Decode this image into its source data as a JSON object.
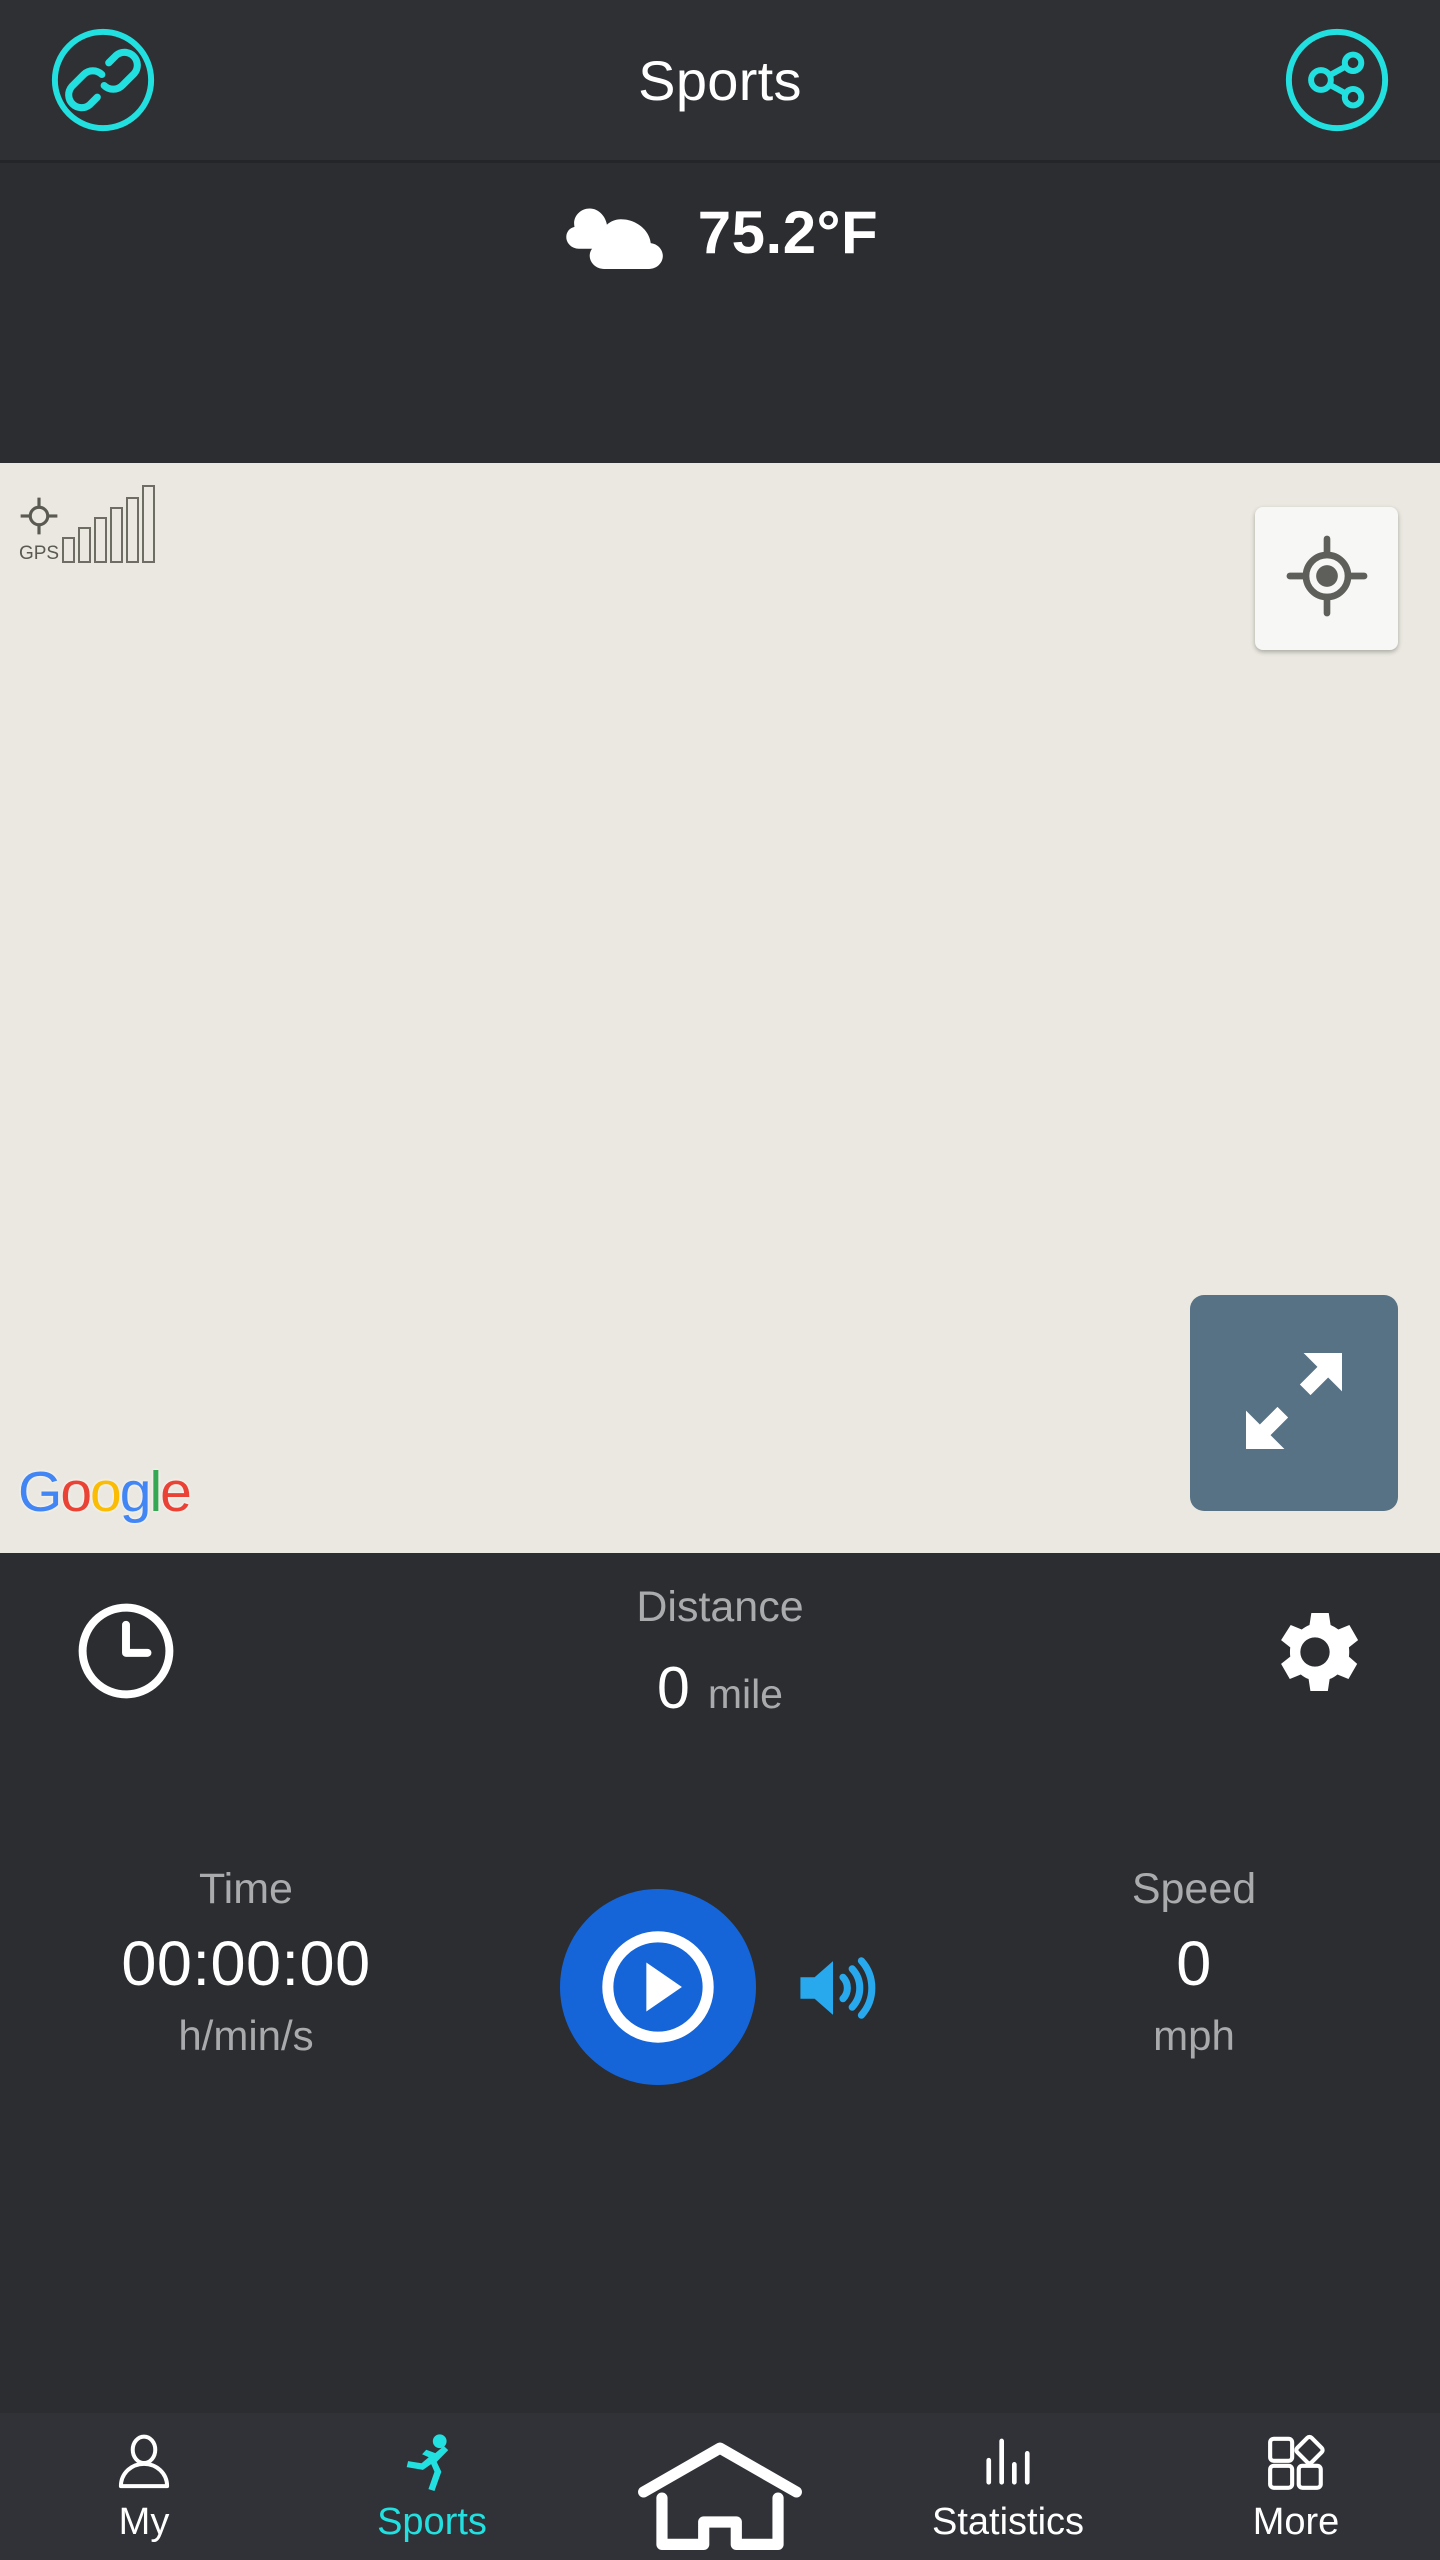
{
  "header": {
    "title": "Sports",
    "left_icon": "link-icon",
    "right_icon": "share-icon",
    "accent_color": "#22e0e0",
    "background_color": "#2e3034"
  },
  "weather": {
    "icon": "cloudy-icon",
    "temperature": "75.2°F"
  },
  "map": {
    "background_color": "#eae8e0",
    "gps": {
      "label": "GPS",
      "icon": "gps-crosshair-icon",
      "bars": 6,
      "bars_filled": 0
    },
    "locate_button": {
      "icon": "my-location-icon",
      "background_color": "#f7f7f5"
    },
    "expand_button": {
      "icon": "expand-arrows-icon",
      "background_color": "#577285"
    },
    "attribution": {
      "name": "Google",
      "letters": [
        {
          "char": "G",
          "color": "#4285F4"
        },
        {
          "char": "o",
          "color": "#EA4335"
        },
        {
          "char": "o",
          "color": "#FBBC05"
        },
        {
          "char": "g",
          "color": "#4285F4"
        },
        {
          "char": "l",
          "color": "#34A853"
        },
        {
          "char": "e",
          "color": "#EA4335"
        }
      ]
    }
  },
  "stats": {
    "background_color": "#2b2d31",
    "history_button": {
      "icon": "clock-icon"
    },
    "settings_button": {
      "icon": "gear-icon"
    },
    "distance": {
      "label": "Distance",
      "value": "0",
      "unit": "mile"
    },
    "time": {
      "label": "Time",
      "value": "00:00:00",
      "unit": "h/min/s"
    },
    "speed": {
      "label": "Speed",
      "value": "0",
      "unit": "mph"
    },
    "start_button": {
      "icon": "play-icon",
      "color": "#1565d8"
    },
    "sound_button": {
      "icon": "volume-up-icon",
      "color": "#28a9ee"
    }
  },
  "nav": {
    "background_color": "#303237",
    "active_color": "#22e0e0",
    "items": [
      {
        "id": "my",
        "label": "My",
        "icon": "person-icon",
        "active": false
      },
      {
        "id": "sports",
        "label": "Sports",
        "icon": "running-icon",
        "active": true
      },
      {
        "id": "home",
        "label": "",
        "icon": "home-icon",
        "active": false
      },
      {
        "id": "statistics",
        "label": "Statistics",
        "icon": "bar-chart-icon",
        "active": false
      },
      {
        "id": "more",
        "label": "More",
        "icon": "grid-more-icon",
        "active": false
      }
    ]
  }
}
